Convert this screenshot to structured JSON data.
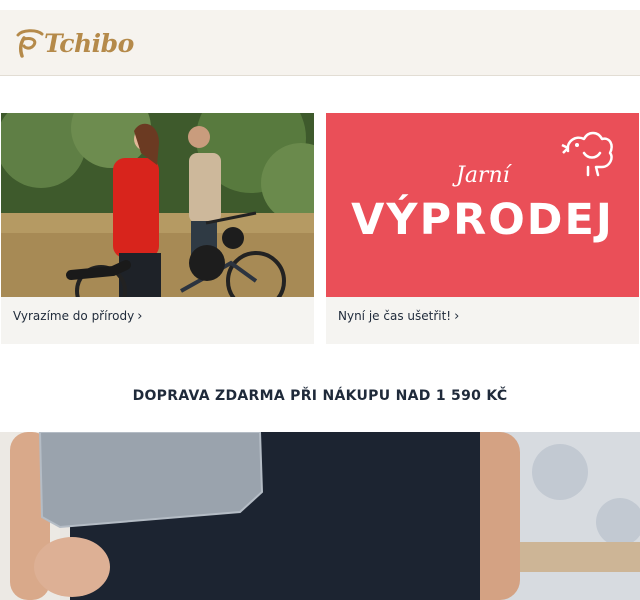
{
  "brand": {
    "name": "Tchibo",
    "logo_icon": "tchibo-bean-logo"
  },
  "promos": [
    {
      "caption": "Vyrazíme do přírody",
      "image_icon": "cycling-couple-photo"
    },
    {
      "caption": "Nyní je čas ušetřit!",
      "sale_small": "Jarní",
      "sale_big": "VÝPRODEJ",
      "icon": "bird-icon"
    }
  ],
  "shipping_banner": "DOPRAVA ZDARMA PŘI NÁKUPU NAD 1 590 KČ",
  "hero": {
    "image_icon": "woman-with-towel-photo"
  },
  "colors": {
    "brand_gold": "#b58a4a",
    "sale_red": "#ea4f58",
    "text_dark": "#1f2a3a",
    "header_bg": "#f6f3ee"
  }
}
